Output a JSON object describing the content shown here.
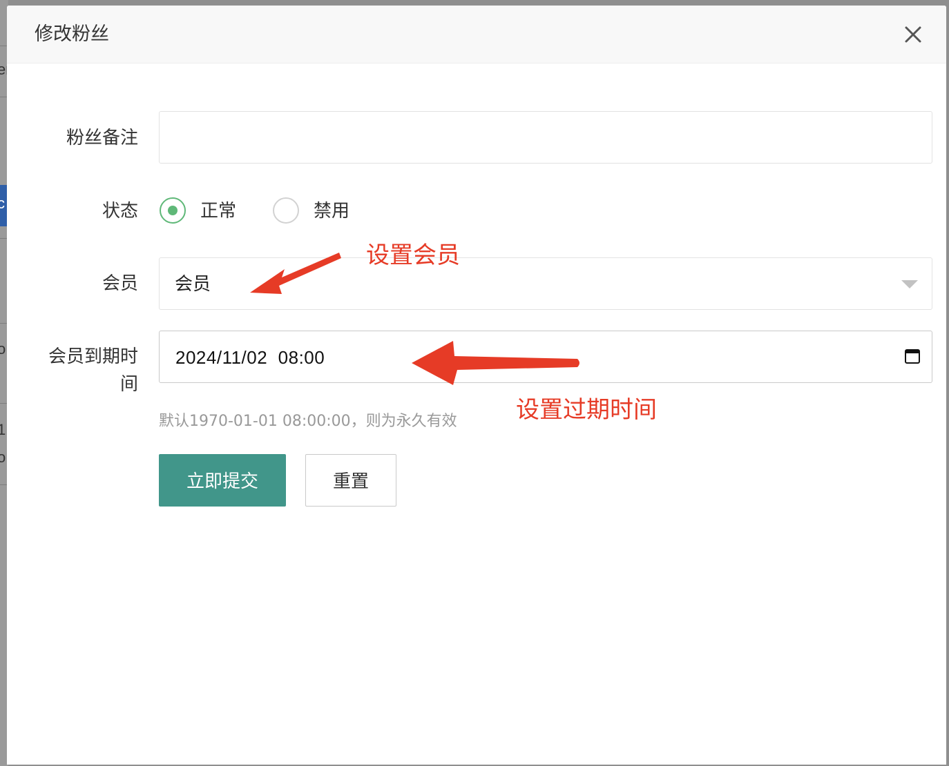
{
  "background": {
    "fragments": [
      "er",
      "c",
      "o",
      "1",
      "o"
    ]
  },
  "dialog": {
    "title": "修改粉丝",
    "close_icon": "close-icon"
  },
  "form": {
    "remark": {
      "label": "粉丝备注",
      "value": ""
    },
    "status": {
      "label": "状态",
      "options": [
        {
          "label": "正常",
          "checked": true
        },
        {
          "label": "禁用",
          "checked": false
        }
      ]
    },
    "member": {
      "label": "会员",
      "selected": "会员"
    },
    "expire": {
      "label_line1": "会员到期时",
      "label_line2": "间",
      "value": "2024/11/02  08:00",
      "help": "默认1970-01-01 08:00:00，则为永久有效"
    },
    "buttons": {
      "submit": "立即提交",
      "reset": "重置"
    }
  },
  "annotations": {
    "member_note": "设置会员",
    "expire_note": "设置过期时间",
    "color": "#e63b26"
  },
  "colors": {
    "primary": "#41968a",
    "radio_checked": "#5fb878"
  }
}
